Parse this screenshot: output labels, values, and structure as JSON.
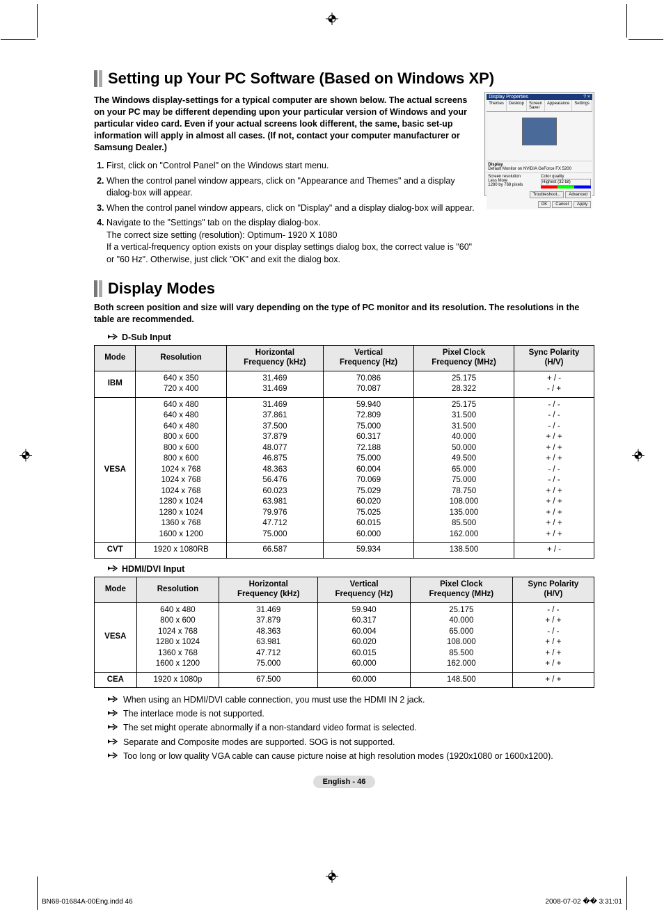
{
  "section1": {
    "title": "Setting up Your PC Software (Based on Windows XP)",
    "intro": "The Windows display-settings for a typical computer are shown below. The actual screens on your PC may be different depending upon your particular version of Windows and your particular video card. Even if your actual screens look different, the same, basic set-up information will apply in almost all cases. (If not, contact your computer manufacturer or Samsung Dealer.)",
    "steps": [
      "First, click on \"Control Panel\" on the Windows start menu.",
      "When the control panel window appears, click on \"Appearance and Themes\" and a display dialog-box will appear.",
      "When the control panel window appears, click on \"Display\" and a display dialog-box will appear.",
      "Navigate to the \"Settings\" tab on the display dialog-box.\nThe correct size setting (resolution): Optimum- 1920 X 1080\nIf a vertical-frequency option exists on your display settings dialog box, the correct value is \"60\" or \"60 Hz\". Otherwise, just click \"OK\" and exit the dialog box."
    ]
  },
  "section2": {
    "title": "Display Modes",
    "intro": "Both screen position and size will vary depending on the type of PC monitor and its resolution. The resolutions in the table are recommended.",
    "dsub_label": "D-Sub Input",
    "hdmi_label": "HDMI/DVI Input",
    "headers": [
      "Mode",
      "Resolution",
      "Horizontal Frequency (kHz)",
      "Vertical Frequency (Hz)",
      "Pixel Clock Frequency (MHz)",
      "Sync Polarity (H/V)"
    ],
    "dsub_rows": [
      {
        "mode": "IBM",
        "res": [
          "640 x 350",
          "720 x 400"
        ],
        "h": [
          "31.469",
          "31.469"
        ],
        "v": [
          "70.086",
          "70.087"
        ],
        "p": [
          "25.175",
          "28.322"
        ],
        "s": [
          "+ / -",
          "- / +"
        ]
      },
      {
        "mode": "VESA",
        "res": [
          "640 x 480",
          "640 x 480",
          "640 x 480",
          "800 x 600",
          "800 x 600",
          "800 x 600",
          "1024 x 768",
          "1024 x 768",
          "1024 x 768",
          "1280 x 1024",
          "1280 x 1024",
          "1360 x 768",
          "1600 x 1200"
        ],
        "h": [
          "31.469",
          "37.861",
          "37.500",
          "37.879",
          "48.077",
          "46.875",
          "48.363",
          "56.476",
          "60.023",
          "63.981",
          "79.976",
          "47.712",
          "75.000"
        ],
        "v": [
          "59.940",
          "72.809",
          "75.000",
          "60.317",
          "72.188",
          "75.000",
          "60.004",
          "70.069",
          "75.029",
          "60.020",
          "75.025",
          "60.015",
          "60.000"
        ],
        "p": [
          "25.175",
          "31.500",
          "31.500",
          "40.000",
          "50.000",
          "49.500",
          "65.000",
          "75.000",
          "78.750",
          "108.000",
          "135.000",
          "85.500",
          "162.000"
        ],
        "s": [
          "- / -",
          "- / -",
          "- / -",
          "+ / +",
          "+ / +",
          "+ / +",
          "- / -",
          "- / -",
          "+ / +",
          "+ / +",
          "+ / +",
          "+ / +",
          "+ / +"
        ]
      },
      {
        "mode": "CVT",
        "res": [
          "1920 x 1080RB"
        ],
        "h": [
          "66.587"
        ],
        "v": [
          "59.934"
        ],
        "p": [
          "138.500"
        ],
        "s": [
          "+ / -"
        ]
      }
    ],
    "hdmi_rows": [
      {
        "mode": "VESA",
        "res": [
          "640 x 480",
          "800 x 600",
          "1024 x 768",
          "1280 x 1024",
          "1360 x 768",
          "1600 x 1200"
        ],
        "h": [
          "31.469",
          "37.879",
          "48.363",
          "63.981",
          "47.712",
          "75.000"
        ],
        "v": [
          "59.940",
          "60.317",
          "60.004",
          "60.020",
          "60.015",
          "60.000"
        ],
        "p": [
          "25.175",
          "40.000",
          "65.000",
          "108.000",
          "85.500",
          "162.000"
        ],
        "s": [
          "- / -",
          "+ / +",
          "- / -",
          "+ / +",
          "+ / +",
          "+ / +"
        ]
      },
      {
        "mode": "CEA",
        "res": [
          "1920 x 1080p"
        ],
        "h": [
          "67.500"
        ],
        "v": [
          "60.000"
        ],
        "p": [
          "148.500"
        ],
        "s": [
          "+ / +"
        ]
      }
    ],
    "notes": [
      "When using an HDMI/DVI cable connection, you must use the HDMI IN 2 jack.",
      "The interlace mode is not supported.",
      "The set might operate abnormally if a non-standard video format is selected.",
      "Separate and Composite modes are supported. SOG is not supported.",
      "Too long or low quality VGA cable can cause picture noise at high resolution modes (1920x1080 or 1600x1200)."
    ]
  },
  "footer": {
    "page_label": "English - 46",
    "doc_id": "BN68-01684A-00Eng.indd   46",
    "timestamp": "2008-07-02   �� 3:31:01"
  },
  "thumb": {
    "title": "Display Properties",
    "tabs": [
      "Themes",
      "Desktop",
      "Screen Saver",
      "Appearance",
      "Settings"
    ],
    "display_label": "Display",
    "display_text": "Default Monitor on NVIDIA GeForce FX 5200",
    "res_label": "Screen resolution",
    "res_slider": "Less     More",
    "res_value": "1280 by 768 pixels",
    "color_label": "Color quality",
    "color_value": "Highest (32 bit)",
    "btn_trouble": "Troubleshoot...",
    "btn_adv": "Advanced",
    "btn_ok": "OK",
    "btn_cancel": "Cancel",
    "btn_apply": "Apply"
  }
}
